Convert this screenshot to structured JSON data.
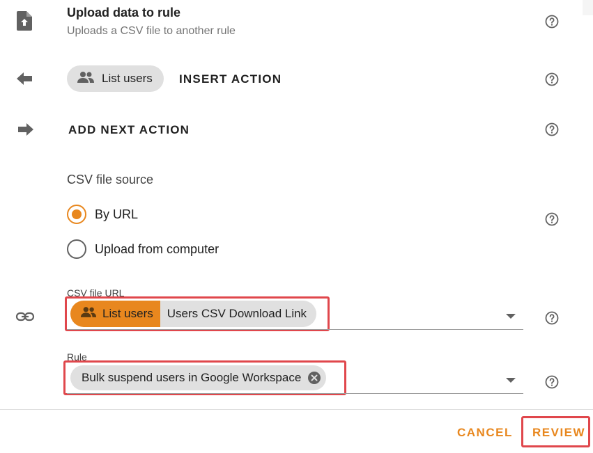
{
  "header": {
    "title": "Upload data to rule",
    "subtitle": "Uploads a CSV file to another rule"
  },
  "insert": {
    "chip_label": "List users",
    "chip_icon": "people-icon",
    "action_label": "INSERT ACTION"
  },
  "next": {
    "action_label": "ADD NEXT ACTION"
  },
  "csv_source": {
    "label": "CSV file source",
    "options": [
      {
        "label": "By URL",
        "checked": true
      },
      {
        "label": "Upload from computer",
        "checked": false
      }
    ]
  },
  "csv_url": {
    "label": "CSV file URL",
    "chip_step": "List users",
    "chip_value": "Users CSV Download Link"
  },
  "rule": {
    "label": "Rule",
    "chip_value": "Bulk suspend users in Google Workspace"
  },
  "footer": {
    "cancel_label": "CANCEL",
    "review_label": "REVIEW"
  },
  "colors": {
    "accent": "#e8871e",
    "highlight": "#e0474c",
    "chip_grey": "#e0e0e0"
  }
}
